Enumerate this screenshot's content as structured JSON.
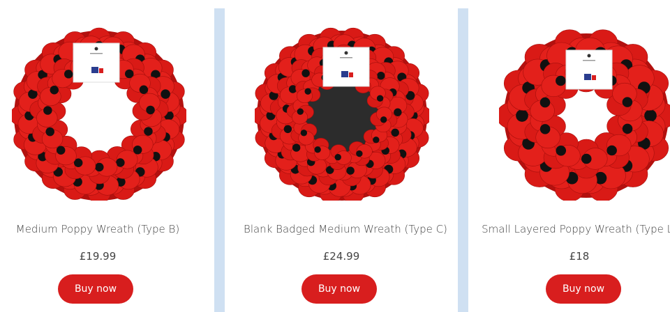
{
  "colors": {
    "divider": "#cfe0f2",
    "button": "#d81e1e",
    "poppy_red": "#e3201b",
    "poppy_center": "#111111"
  },
  "products": [
    {
      "title": "Medium Poppy Wreath (Type B)",
      "price": "£19.99",
      "button_label": "Buy now",
      "image_icon": "poppy-wreath-open-centre"
    },
    {
      "title": "Blank Badged Medium Wreath (Type C)",
      "price": "£24.99",
      "button_label": "Buy now",
      "image_icon": "poppy-wreath-black-centre"
    },
    {
      "title": "Small Layered Poppy Wreath (Type L)",
      "price": "£18",
      "button_label": "Buy now",
      "image_icon": "poppy-wreath-layered"
    }
  ]
}
